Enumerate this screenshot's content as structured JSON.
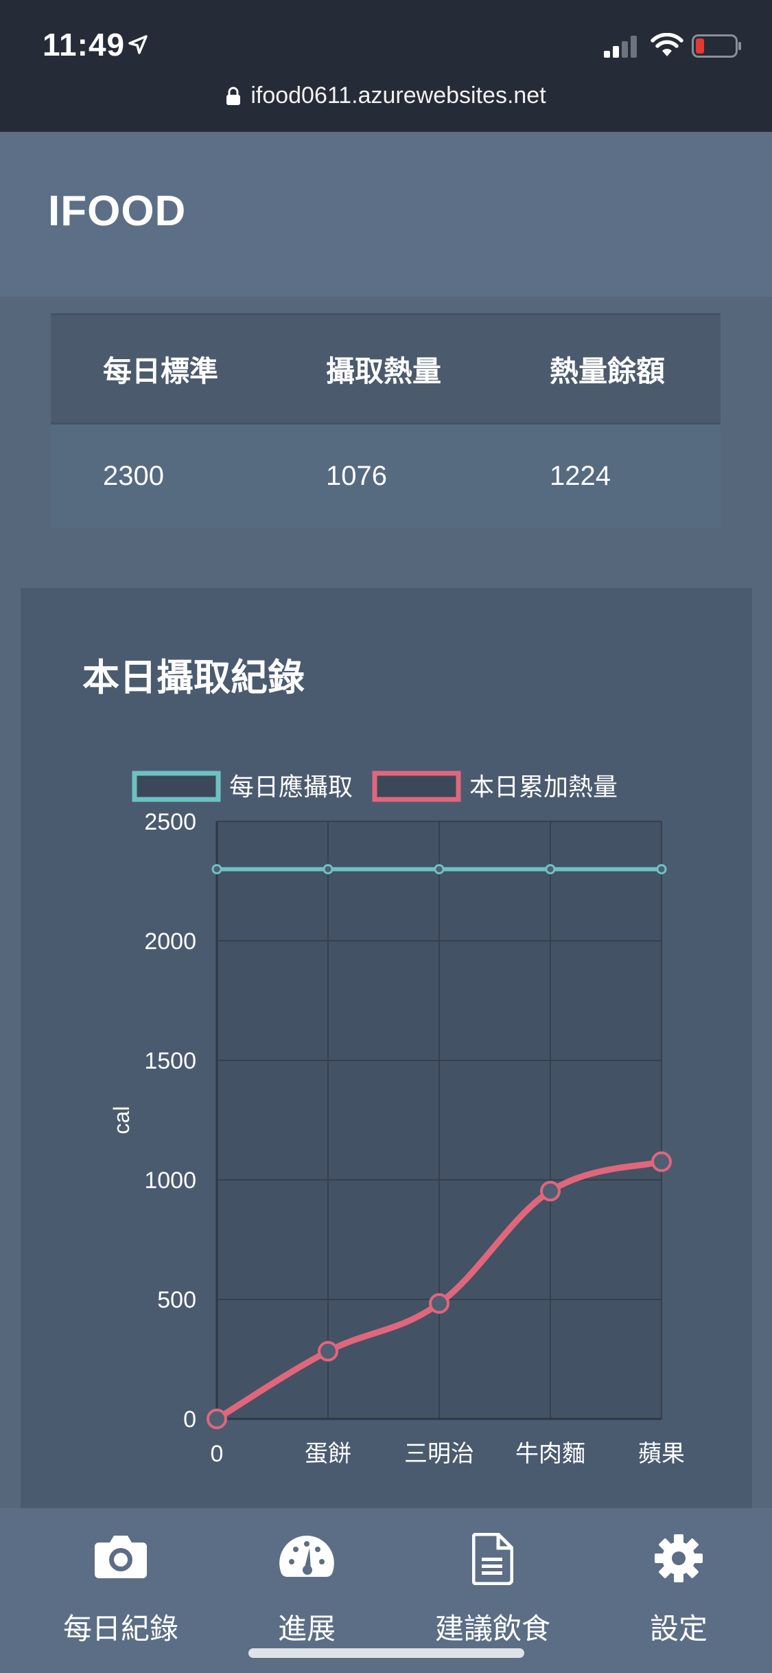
{
  "status_bar": {
    "time": "11:49",
    "url": "ifood0611.azurewebsites.net"
  },
  "app": {
    "title": "IFOOD"
  },
  "calorie_table": {
    "headers": [
      "每日標準",
      "攝取熱量",
      "熱量餘額"
    ],
    "values": [
      "2300",
      "1076",
      "1224"
    ]
  },
  "chart": {
    "card_title": "本日攝取紀錄"
  },
  "chart_data": {
    "type": "line",
    "title": "",
    "xlabel": "",
    "ylabel": "cal",
    "categories": [
      "0",
      "蛋餅",
      "三明治",
      "牛肉麵",
      "蘋果"
    ],
    "ylim": [
      0,
      2500
    ],
    "yticks": [
      "2500",
      "2000",
      "1500",
      "1000",
      "500",
      "0"
    ],
    "grid": true,
    "legend_position": "top",
    "series": [
      {
        "name": "每日應攝取",
        "color": "#6cc2c2",
        "values": [
          2300,
          2300,
          2300,
          2300,
          2300
        ]
      },
      {
        "name": "本日累加熱量",
        "color": "#e0667c",
        "values": [
          0,
          283,
          483,
          953,
          1076
        ]
      }
    ]
  },
  "bottom_nav": {
    "items": [
      {
        "label": "每日紀錄",
        "icon": "camera-icon"
      },
      {
        "label": "進展",
        "icon": "gauge-icon"
      },
      {
        "label": "建議飲食",
        "icon": "document-icon"
      },
      {
        "label": "設定",
        "icon": "gear-icon"
      }
    ]
  }
}
